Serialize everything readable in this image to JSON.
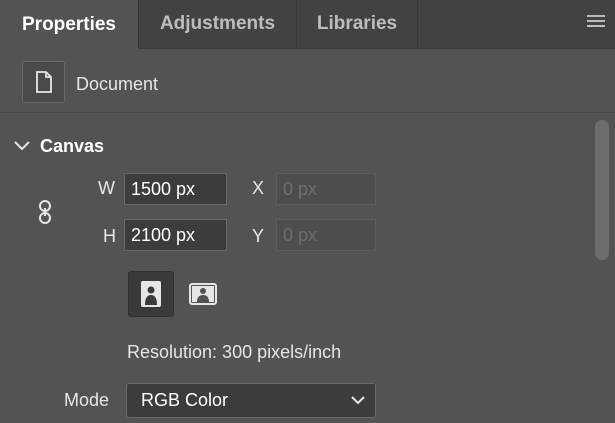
{
  "tabs": [
    {
      "label": "Properties",
      "active": true
    },
    {
      "label": "Adjustments",
      "active": false
    },
    {
      "label": "Libraries",
      "active": false
    }
  ],
  "panel_menu_icon": "hamburger-menu-icon",
  "document": {
    "icon": "document-icon",
    "label": "Document"
  },
  "canvas": {
    "section_label": "Canvas",
    "collapse_icon": "chevron-down-icon",
    "link_icon": "link-chain-icon",
    "width": {
      "label": "W",
      "value": "1500 px"
    },
    "height": {
      "label": "H",
      "value": "2100 px"
    },
    "x": {
      "label": "X",
      "placeholder": "0 px"
    },
    "y": {
      "label": "Y",
      "placeholder": "0 px"
    },
    "orientation": {
      "selected": "portrait",
      "icons": [
        "portrait-orientation-icon",
        "landscape-orientation-icon"
      ]
    },
    "resolution": "Resolution: 300 pixels/inch",
    "mode": {
      "label": "Mode",
      "value": "RGB Color"
    }
  },
  "colors": {
    "panel_bg": "#535353",
    "tabbar_bg": "#424242",
    "input_bg": "#3c3c3c",
    "text": "#e6e6e6"
  }
}
